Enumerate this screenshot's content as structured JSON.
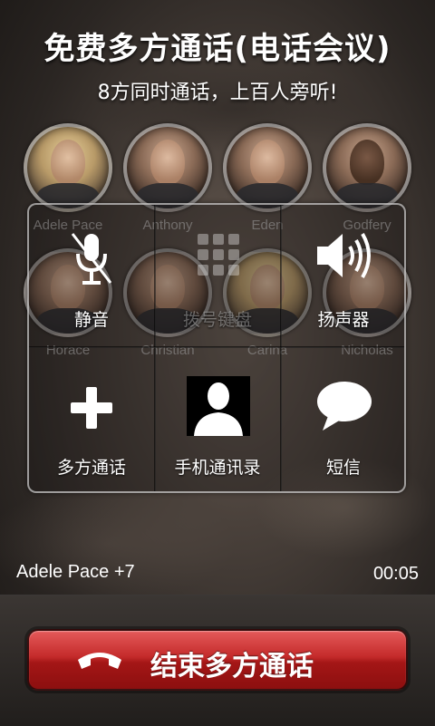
{
  "header": {
    "title": "免费多方通话(电话会议)",
    "subtitle": "8方同时通话，上百人旁听!"
  },
  "participants": [
    {
      "name": "Adele Pace"
    },
    {
      "name": "Anthony"
    },
    {
      "name": "Eden"
    },
    {
      "name": "Godfery"
    },
    {
      "name": "Horace"
    },
    {
      "name": "Christian"
    },
    {
      "name": "Carina"
    },
    {
      "name": "Nicholas"
    }
  ],
  "controls": {
    "mute": {
      "label": "静音",
      "icon": "mic-off-icon"
    },
    "keypad": {
      "label": "拨号键盘",
      "icon": "keypad-icon",
      "enabled": false
    },
    "speaker": {
      "label": "扬声器",
      "icon": "speaker-icon"
    },
    "add_call": {
      "label": "多方通话",
      "icon": "plus-icon"
    },
    "contacts": {
      "label": "手机通讯录",
      "icon": "contact-icon"
    },
    "sms": {
      "label": "短信",
      "icon": "chat-bubble-icon"
    }
  },
  "call_status": {
    "caller": "Adele Pace +7",
    "duration": "00:05"
  },
  "end_call": {
    "label": "结束多方通话",
    "icon": "hang-up-icon",
    "color": "#c42a2a"
  }
}
